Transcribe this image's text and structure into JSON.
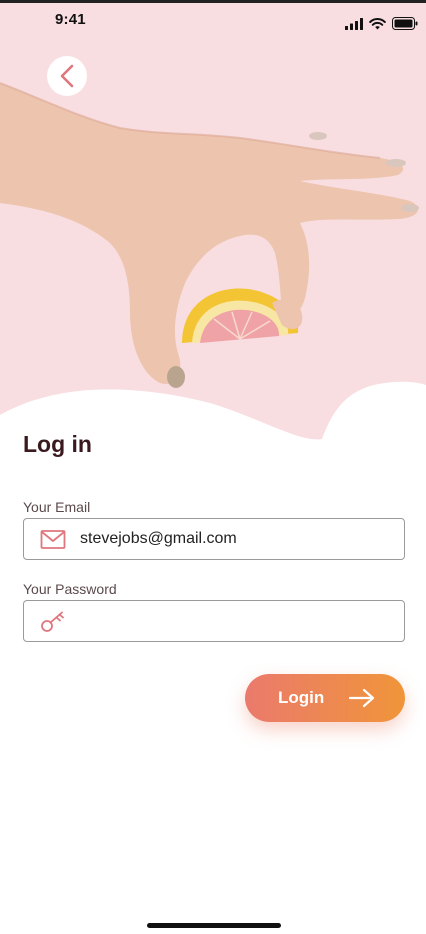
{
  "status_bar": {
    "time": "9:41",
    "icons": [
      "cellular-signal-icon",
      "wifi-icon",
      "battery-icon"
    ]
  },
  "nav": {
    "back_icon": "chevron-left-icon"
  },
  "hero": {
    "image": "hand-holding-grapefruit-slice"
  },
  "form": {
    "title": "Log in",
    "email": {
      "label": "Your Email",
      "value": "stevejobs@gmail.com",
      "icon": "mail-icon"
    },
    "password": {
      "label": "Your Password",
      "value": "",
      "icon": "key-icon"
    },
    "login_button": {
      "label": "Login",
      "icon": "arrow-right-icon"
    }
  },
  "colors": {
    "hero_background": "#f8dde1",
    "accent": "#e0767e",
    "button_gradient_start": "#ea7a6c",
    "button_gradient_end": "#f0953a",
    "title": "#3a1a1e"
  }
}
